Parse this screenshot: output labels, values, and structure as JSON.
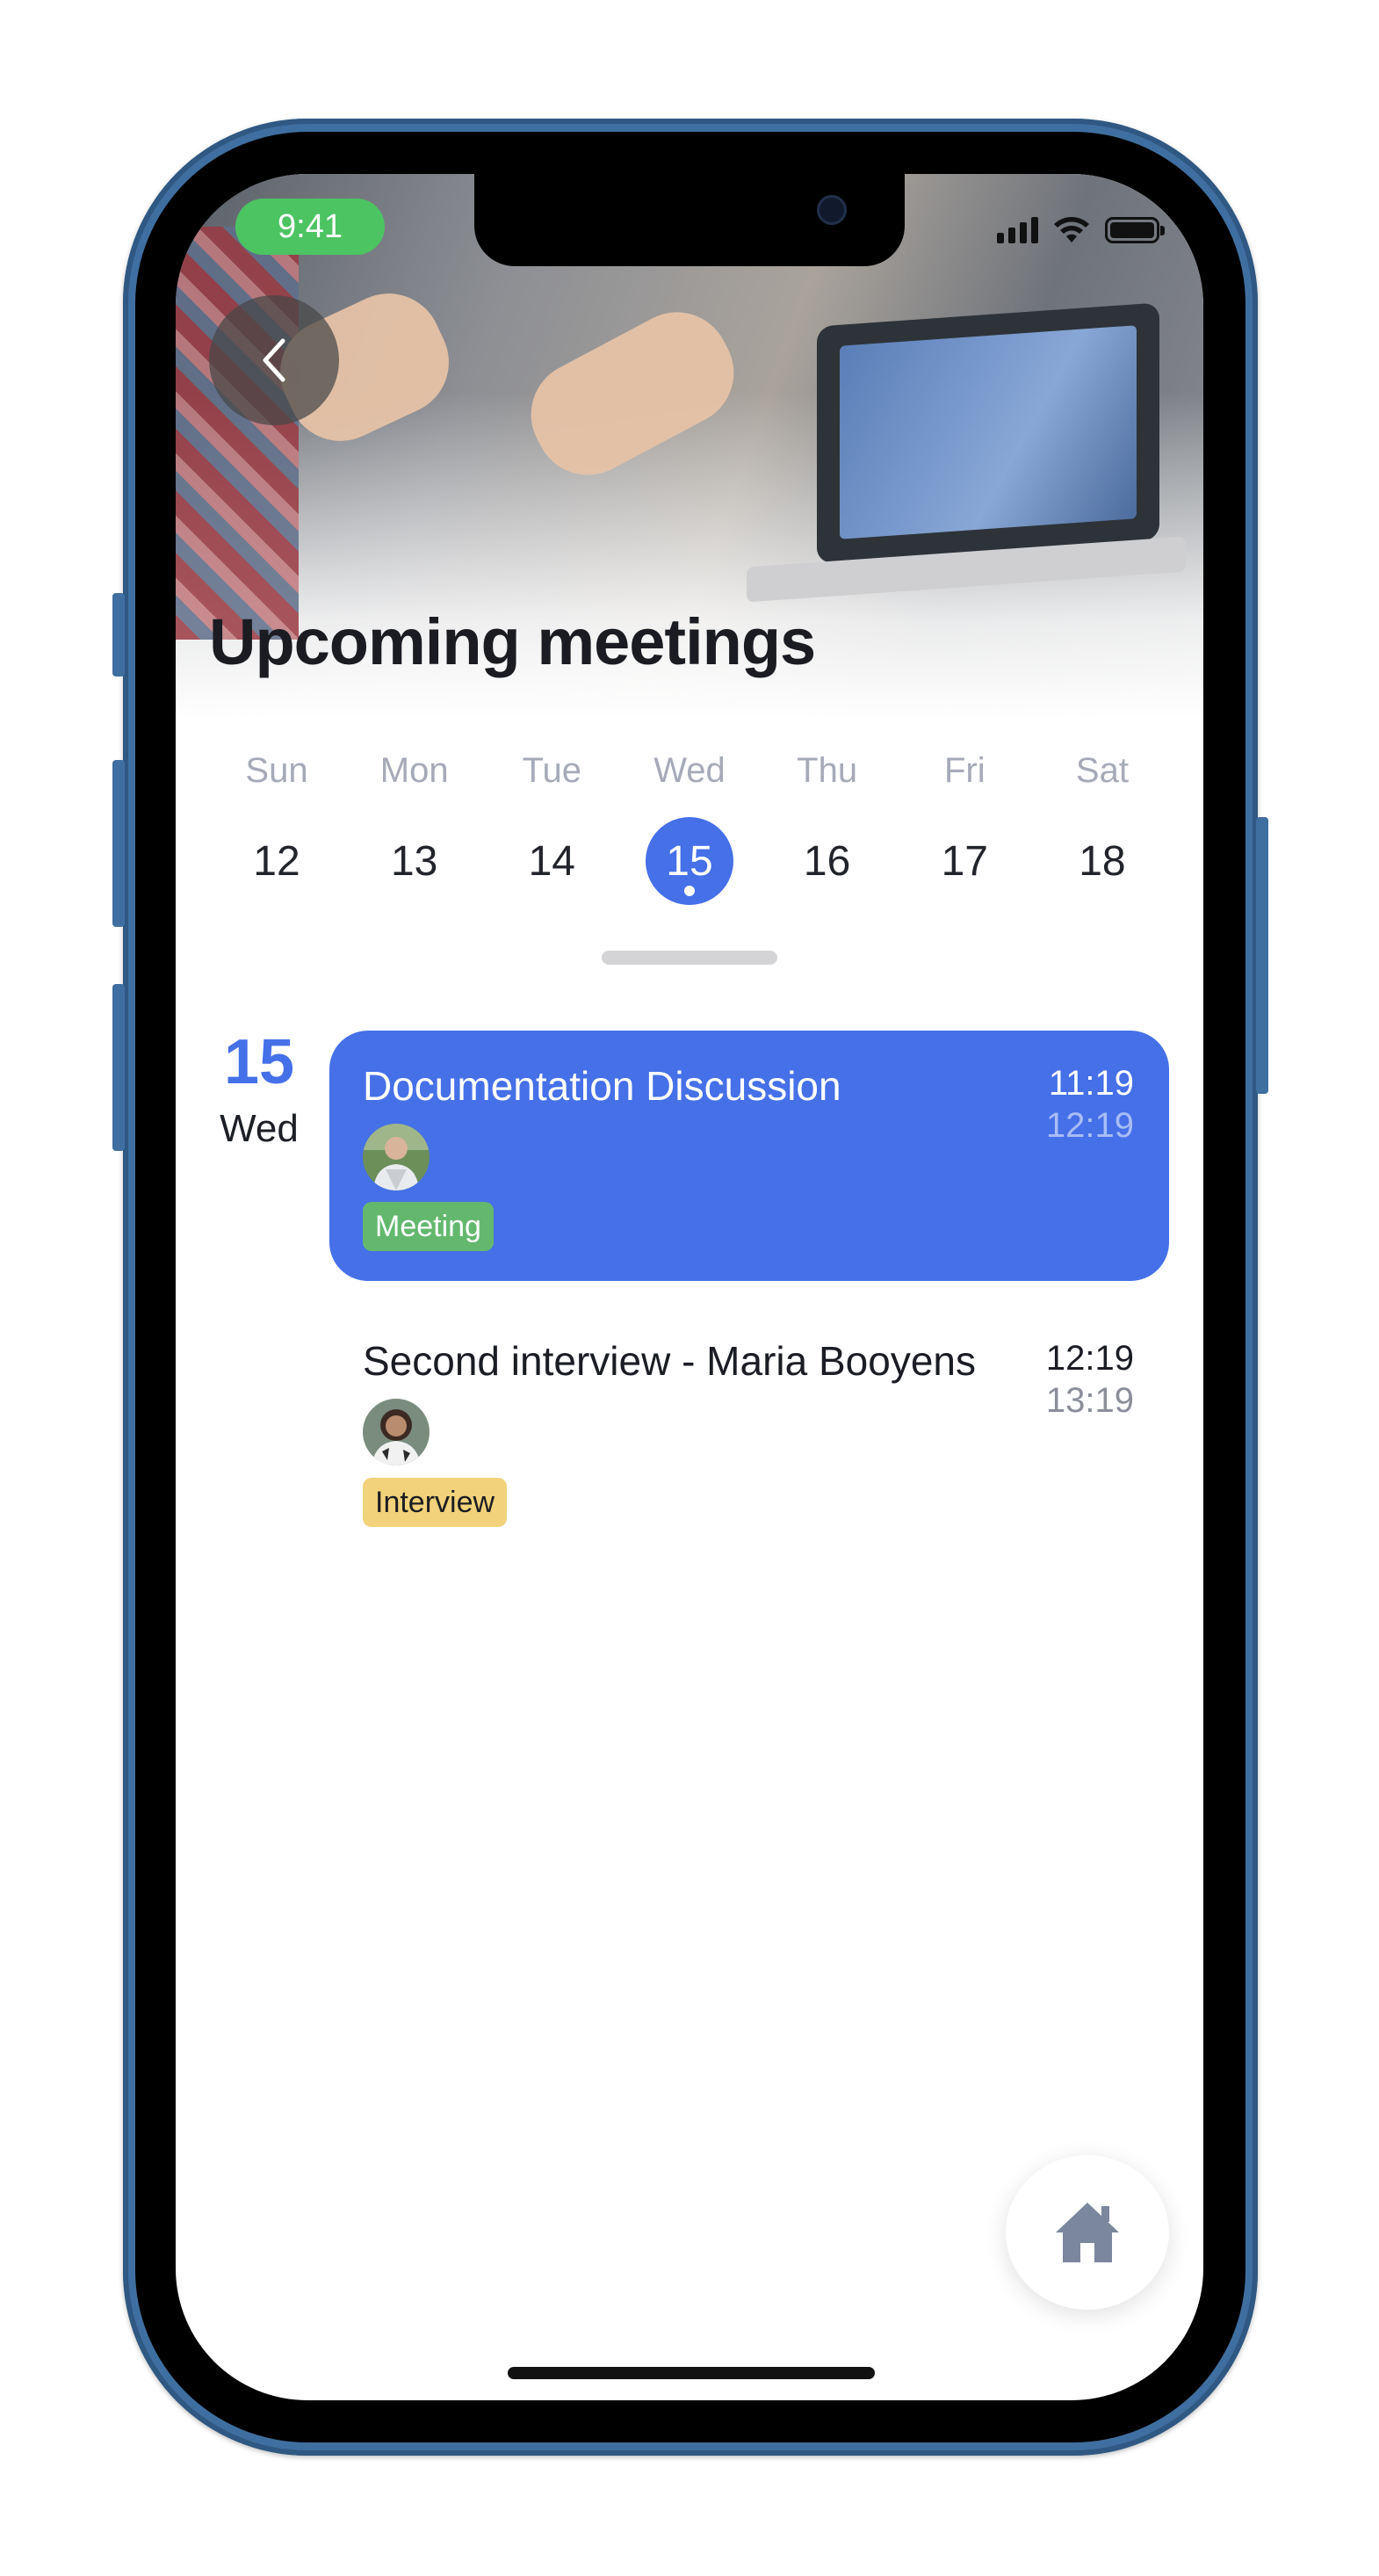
{
  "status_bar": {
    "time": "9:41"
  },
  "header": {
    "title": "Upcoming meetings"
  },
  "week": [
    {
      "dow": "Sun",
      "day": "12",
      "selected": false
    },
    {
      "dow": "Mon",
      "day": "13",
      "selected": false
    },
    {
      "dow": "Tue",
      "day": "14",
      "selected": false
    },
    {
      "dow": "Wed",
      "day": "15",
      "selected": true
    },
    {
      "dow": "Thu",
      "day": "16",
      "selected": false
    },
    {
      "dow": "Fri",
      "day": "17",
      "selected": false
    },
    {
      "dow": "Sat",
      "day": "18",
      "selected": false
    }
  ],
  "selected_date": {
    "day": "15",
    "dow": "Wed"
  },
  "events": [
    {
      "title": "Documentation Discussion",
      "start": "11:19",
      "end": "12:19",
      "tag": "Meeting",
      "tag_color": "#63b86e"
    },
    {
      "title": "Second interview - Maria Booyens",
      "start": "12:19",
      "end": "13:19",
      "tag": "Interview",
      "tag_color": "#f2d27a"
    }
  ],
  "colors": {
    "accent": "#4570e8",
    "frame": "#3f6fa0",
    "status_time_bg": "#4cc462"
  },
  "icons": [
    "back-chevron-icon",
    "signal-icon",
    "wifi-icon",
    "battery-icon",
    "home-icon"
  ]
}
